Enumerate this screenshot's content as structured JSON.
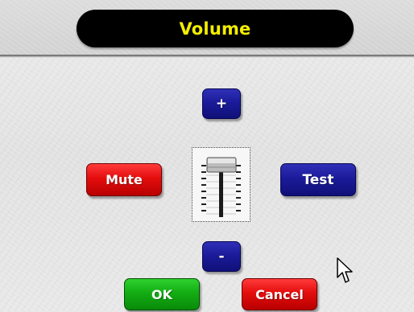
{
  "window": {
    "title": "Volume"
  },
  "controls": {
    "volume_up_label": "+",
    "volume_down_label": "-",
    "mute_label": "Mute",
    "test_label": "Test",
    "ok_label": "OK",
    "cancel_label": "Cancel"
  },
  "colors": {
    "title_text": "#f4ee00",
    "title_background": "#000000",
    "blue_button": "#1b1b9a",
    "red_button": "#e40d0d",
    "green_button": "#13ad13"
  },
  "icons": {
    "volume_slider": "volume-slider-icon",
    "pointer": "mouse-pointer-icon"
  }
}
